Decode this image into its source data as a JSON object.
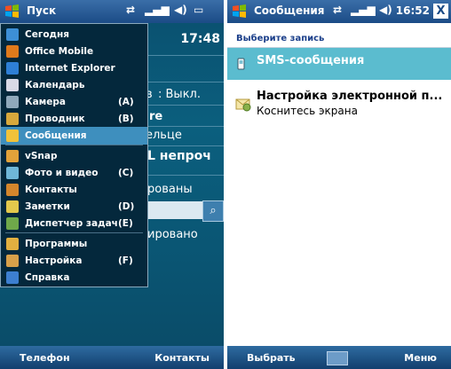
{
  "left_screen": {
    "status_bar": {
      "title": "Пуск"
    },
    "today_background": {
      "time": "17:48",
      "bluetooth_status": ": Выкл.",
      "line_re": "re",
      "line_ellce": "ельце",
      "line_nepro": "L непроч",
      "line_rovany": "рованы",
      "line_rovano": "ировано"
    },
    "start_menu": {
      "items": [
        {
          "label": "Сегодня",
          "shortcut": "",
          "icon": "today-icon",
          "color": "#3d8fd6"
        },
        {
          "label": "Office Mobile",
          "shortcut": "",
          "icon": "office-icon",
          "color": "#e07a1c"
        },
        {
          "label": "Internet Explorer",
          "shortcut": "",
          "icon": "internet-explorer-icon",
          "color": "#2e7fd6"
        },
        {
          "label": "Календарь",
          "shortcut": "",
          "icon": "calendar-icon",
          "color": "#d9d9e6"
        },
        {
          "label": "Камера",
          "shortcut": "(A)",
          "icon": "camera-icon",
          "color": "#8fa8bb"
        },
        {
          "label": "Проводник",
          "shortcut": "(B)",
          "icon": "explorer-icon",
          "color": "#d8a83c"
        },
        {
          "label": "Сообщения",
          "shortcut": "",
          "icon": "messaging-icon",
          "color": "#f0c23a",
          "selected": true
        },
        {
          "label": "vSnap",
          "shortcut": "",
          "icon": "vsnap-icon",
          "color": "#e2a23a"
        },
        {
          "label": "Фото и видео",
          "shortcut": "(C)",
          "icon": "photos-icon",
          "color": "#6fb7d8"
        },
        {
          "label": "Контакты",
          "shortcut": "",
          "icon": "contacts-icon",
          "color": "#d4862c"
        },
        {
          "label": "Заметки",
          "shortcut": "(D)",
          "icon": "notes-icon",
          "color": "#e3c84c"
        },
        {
          "label": "Диспетчер задач",
          "shortcut": "(E)",
          "icon": "task-manager-icon",
          "color": "#6fa84a"
        },
        {
          "label": "Программы",
          "shortcut": "",
          "icon": "programs-icon",
          "color": "#e2b040"
        },
        {
          "label": "Настройка",
          "shortcut": "(F)",
          "icon": "settings-icon",
          "color": "#d8a04a"
        },
        {
          "label": "Справка",
          "shortcut": "",
          "icon": "help-icon",
          "color": "#3d7fd0"
        }
      ]
    },
    "softkeys": {
      "left": "Телефон",
      "right": "Контакты"
    }
  },
  "right_screen": {
    "status_bar": {
      "title": "Сообщения",
      "time": "16:52",
      "close": "X"
    },
    "header": "Выберите запись",
    "list": [
      {
        "title": "SMS-сообщения",
        "subtitle": ""
      },
      {
        "title": "Настройка электронной п...",
        "subtitle": "Коснитесь экрана"
      }
    ],
    "softkeys": {
      "left": "Выбрать",
      "right": "Меню"
    }
  },
  "colors": {
    "accent": "#1b4b86",
    "selection": "#5bbccf",
    "today_bg": "#0b5f7e"
  }
}
